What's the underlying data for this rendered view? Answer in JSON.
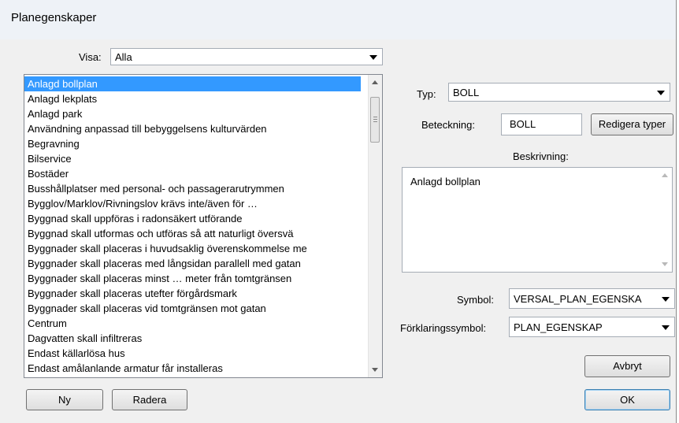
{
  "window": {
    "title": "Planegenskaper"
  },
  "visa": {
    "label": "Visa:",
    "value": "Alla"
  },
  "list": {
    "items": [
      "Anlagd bollplan",
      "Anlagd lekplats",
      "Anlagd park",
      "Användning anpassad till bebyggelsens kulturvärden",
      "Begravning",
      "Bilservice",
      "Bostäder",
      "Busshållplatser med personal- och passagerarutrymmen",
      "Bygglov/Marklov/Rivningslov krävs inte/även för …",
      "Byggnad skall uppföras i radonsäkert utförande",
      "Byggnad skall utformas och utföras så att naturligt översvä",
      "Byggnader skall placeras i huvudsaklig överenskommelse me",
      "Byggnader skall placeras med långsidan parallell med gatan",
      "Byggnader skall placeras minst … meter från tomtgränsen",
      "Byggnader skall placeras utefter förgårdsmark",
      "Byggnader skall placeras vid tomtgränsen mot gatan",
      "Centrum",
      "Dagvatten skall infiltreras",
      "Endast källarlösa hus",
      "Endast amålanlande armatur får installeras"
    ],
    "selected_index": 0
  },
  "typ": {
    "label": "Typ:",
    "value": "BOLL"
  },
  "beteckning": {
    "label": "Beteckning:",
    "value": "BOLL"
  },
  "buttons": {
    "edit_types": "Redigera typer",
    "new": "Ny",
    "delete": "Radera",
    "cancel": "Avbryt",
    "ok": "OK"
  },
  "beskrivning": {
    "label": "Beskrivning:",
    "value": "Anlagd bollplan"
  },
  "symbol": {
    "label": "Symbol:",
    "value": "VERSAL_PLAN_EGENSKA"
  },
  "forklaringssymbol": {
    "label": "Förklaringssymbol:",
    "value": "PLAN_EGENSKAP"
  },
  "colors": {
    "selection": "#3399ff",
    "dialog_bg": "#f0f0f0",
    "title_bg": "#eef2f7"
  }
}
